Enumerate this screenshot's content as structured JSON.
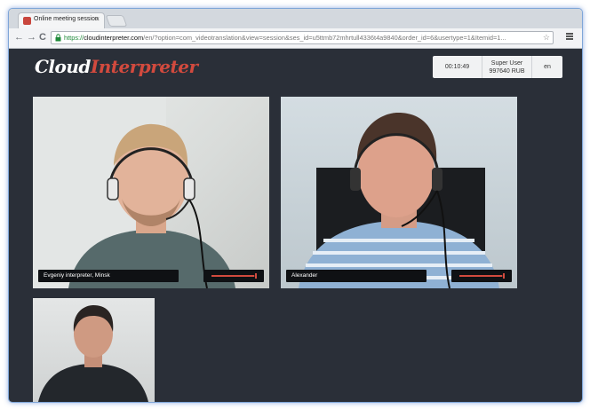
{
  "browser": {
    "tab_title": "Online meeting session",
    "tab_close": "×",
    "url_protocol": "https://",
    "url_host": "cloudinterpreter.com",
    "url_path": "/en/?option=com_videotranslation&view=session&ses_id=u5ttmb72mhrtull4336t4a9840&order_id=6&usertype=1&Itemid=1...",
    "back_glyph": "←",
    "forward_glyph": "→",
    "reload_glyph": "C"
  },
  "app": {
    "logo_part1": "Cloud",
    "logo_part2": "Interpreter",
    "timer": "00:10:49",
    "user_name": "Super User",
    "balance": "997640 RUB",
    "language": "en",
    "brand_color": "#d24a3e"
  },
  "participants": [
    {
      "name": "Evgeniy interpreter, Minsk",
      "audio_level": 0.95
    },
    {
      "name": "Alexander",
      "audio_level": 0.95
    }
  ],
  "self_view": {
    "label": ""
  }
}
